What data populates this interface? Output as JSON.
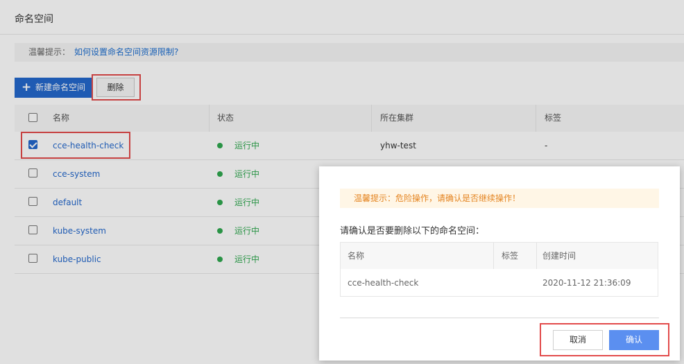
{
  "page": {
    "title": "命名空间",
    "tip": {
      "label": "温馨提示：",
      "link": "如何设置命名空间资源限制?"
    }
  },
  "toolbar": {
    "new_label": "新建命名空间",
    "delete_label": "删除"
  },
  "table": {
    "columns": [
      "名称",
      "状态",
      "所在集群",
      "标签"
    ],
    "rows": [
      {
        "name": "cce-health-check",
        "status": "运行中",
        "cluster": "yhw-test",
        "tags": "-",
        "checked": true
      },
      {
        "name": "cce-system",
        "status": "运行中",
        "cluster": "",
        "tags": "",
        "checked": false
      },
      {
        "name": "default",
        "status": "运行中",
        "cluster": "",
        "tags": "",
        "checked": false
      },
      {
        "name": "kube-system",
        "status": "运行中",
        "cluster": "",
        "tags": "",
        "checked": false
      },
      {
        "name": "kube-public",
        "status": "运行中",
        "cluster": "",
        "tags": "",
        "checked": false
      }
    ]
  },
  "dialog": {
    "warning": "温馨提示：危险操作，请确认是否继续操作！",
    "question": "请确认是否要删除以下的命名空间：",
    "columns": [
      "名称",
      "标签",
      "创建时间"
    ],
    "rows": [
      {
        "name": "cce-health-check",
        "tags": "",
        "created": "2020-11-12 21:36:09"
      }
    ],
    "cancel_label": "取消",
    "confirm_label": "确认"
  },
  "colors": {
    "primary": "#2468cc",
    "running": "#2fa84f",
    "warning": "#e48420",
    "highlight": "#e24a4a",
    "confirm": "#5b8ff0"
  }
}
